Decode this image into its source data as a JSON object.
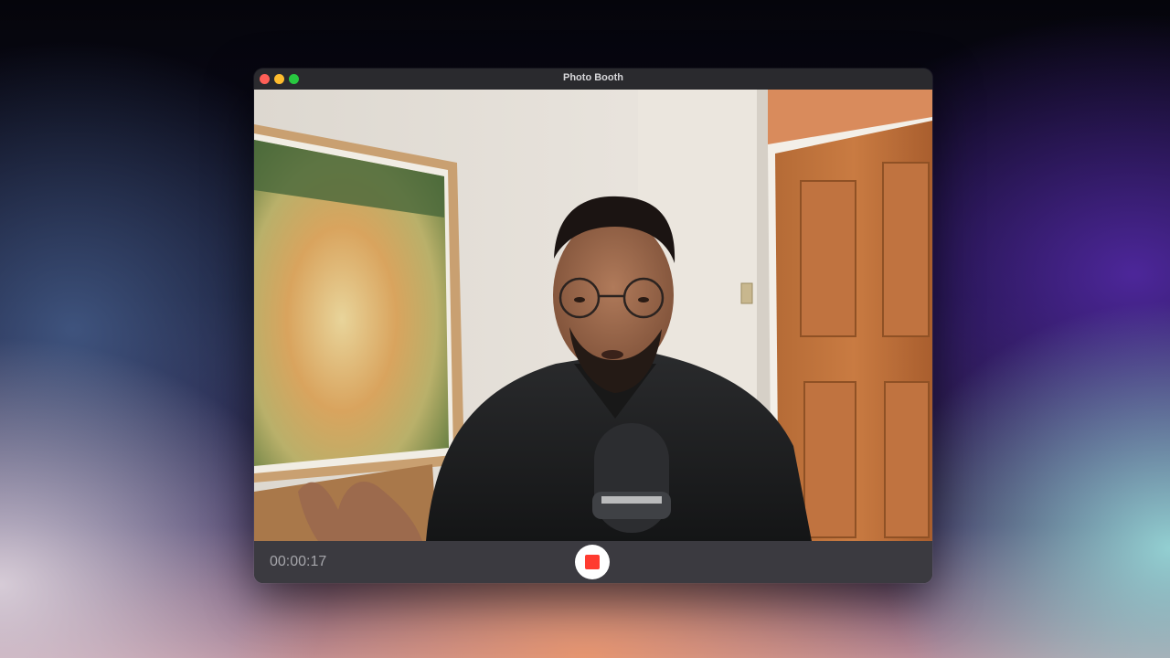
{
  "window": {
    "title": "Photo Booth"
  },
  "controls": {
    "timer": "00:00:17",
    "record_state": "recording"
  },
  "icons": {
    "close": "close-traffic-light-icon",
    "minimize": "minimize-traffic-light-icon",
    "zoom": "zoom-traffic-light-icon",
    "stop": "stop-square-icon"
  },
  "colors": {
    "close": "#ff5f57",
    "minimize": "#febc2e",
    "zoom": "#28c840",
    "record_stop": "#ff3b30"
  }
}
